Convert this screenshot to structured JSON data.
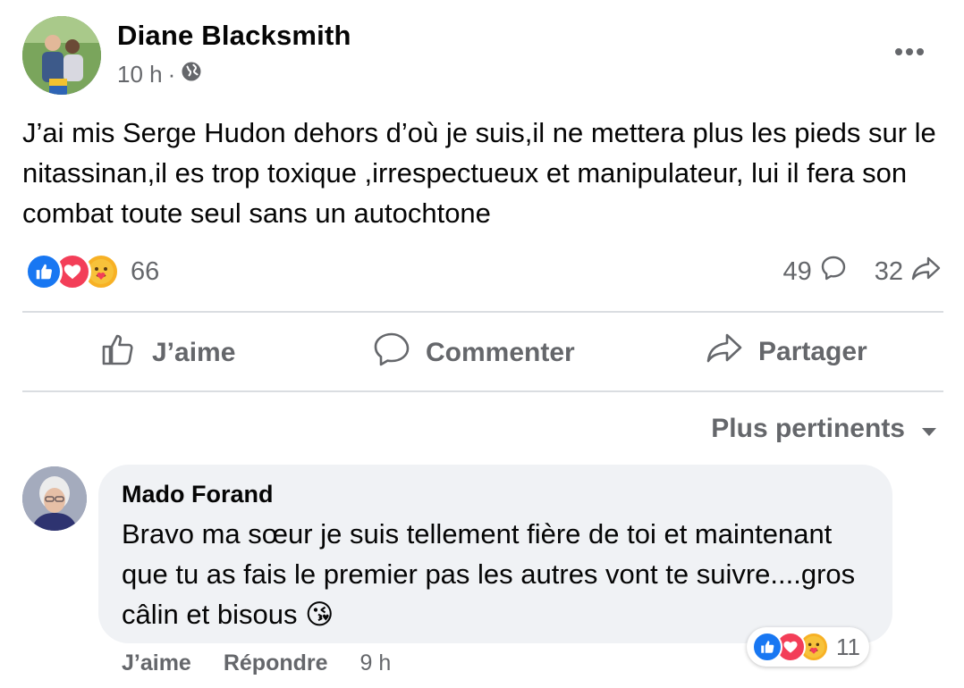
{
  "post": {
    "author": "Diane Blacksmith",
    "time": "10 h",
    "meta_separator": "·",
    "privacy_icon": "globe-icon",
    "text": "J’ai mis Serge Hudon dehors d’où je suis,il ne mettera plus les pieds sur le nitassinan,il es trop toxique ,irrespectueux et manipulateur, lui il fera son combat toute seul sans un autochtone",
    "reactions": [
      "like",
      "love",
      "care"
    ],
    "reaction_count": "66",
    "comment_count": "49",
    "share_count": "32"
  },
  "actions": {
    "like": "J’aime",
    "comment": "Commenter",
    "share": "Partager"
  },
  "sort": {
    "label": "Plus pertinents"
  },
  "comment": {
    "author": "Mado Forand",
    "text": "Bravo ma sœur je suis tellement fière de toi et maintenant que tu as fais le premier pas les autres vont te suivre....gros câlin et bisous",
    "emoji": "😘",
    "reactions": [
      "like",
      "love",
      "care"
    ],
    "reaction_count": "11",
    "like_label": "J’aime",
    "reply_label": "Répondre",
    "time": "9 h"
  },
  "colors": {
    "text": "#050505",
    "secondary": "#65676b",
    "like_blue": "#1877f2",
    "love_red": "#f33e58",
    "care_yellow": "#f7b125",
    "bubble": "#f0f2f5",
    "divider": "#dadde1"
  }
}
